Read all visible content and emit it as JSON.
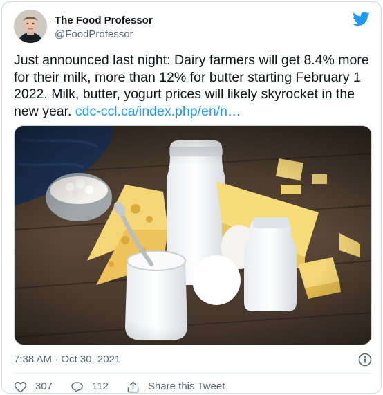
{
  "author": {
    "name": "The Food Professor",
    "handle": "@FoodProfessor"
  },
  "icons": {
    "brand": "twitter-bird-icon",
    "info": "info-icon",
    "like": "heart-icon",
    "reply": "reply-icon",
    "share": "share-icon"
  },
  "colors": {
    "brand": "#1d9bf0",
    "link": "#1d9bf0",
    "text": "#0f1419",
    "muted": "#536471"
  },
  "tweet": {
    "text": "Just announced last night: Dairy farmers will get 8.4% more for their milk, more than 12% for butter starting February 1 2022. Milk, butter, yogurt prices will likely skyrocket in the new year.",
    "link": "cdc-ccl.ca/index.php/en/n…"
  },
  "meta": {
    "timestamp": "7:38 AM · Oct 30, 2021"
  },
  "actions": {
    "likes": "307",
    "replies": "112",
    "share_label": "Share this Tweet"
  }
}
